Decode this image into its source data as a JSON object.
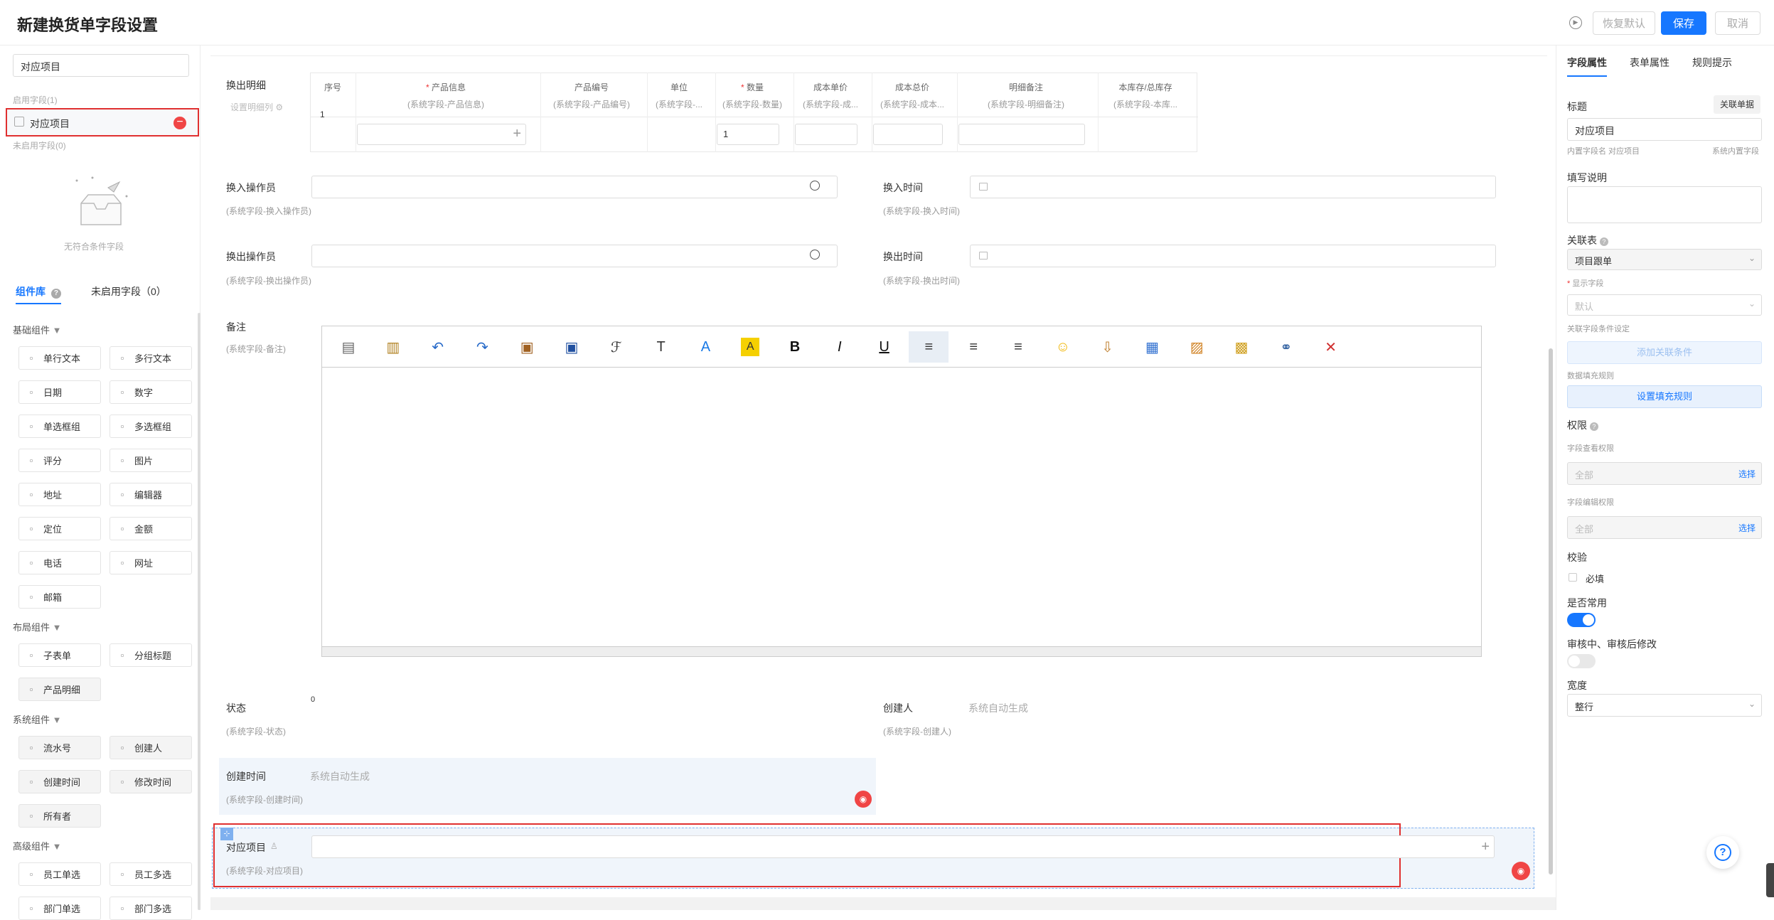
{
  "header": {
    "title": "新建换货单字段设置",
    "restore_label": "恢复默认",
    "save_label": "保存",
    "cancel_label": "取消"
  },
  "left": {
    "search_value": "对应项目",
    "enabled_heading": "启用字段(1)",
    "enabled_item": "对应项目",
    "disabled_heading": "未启用字段(0)",
    "empty_text": "无符合条件字段",
    "tab_library": "组件库",
    "tab_unused": "未启用字段（0）",
    "groups": {
      "basic": "基础组件",
      "layout": "布局组件",
      "system": "系统组件",
      "advanced": "高级组件"
    },
    "basic_items": [
      "单行文本",
      "多行文本",
      "日期",
      "数字",
      "单选框组",
      "多选框组",
      "评分",
      "图片",
      "地址",
      "编辑器",
      "定位",
      "金额",
      "电话",
      "网址",
      "邮箱"
    ],
    "layout_items": [
      "子表单",
      "分组标题",
      "产品明细"
    ],
    "system_items": [
      "流水号",
      "创建人",
      "创建时间",
      "修改时间",
      "所有者"
    ],
    "advanced_items": [
      "员工单选",
      "员工多选",
      "部门单选",
      "部门多选"
    ]
  },
  "form": {
    "detail_label": "换出明细",
    "detail_link": "设置明细列",
    "table_headers": [
      {
        "name": "序号",
        "sub": "",
        "req": false
      },
      {
        "name": "产品信息",
        "sub": "(系统字段-产品信息)",
        "req": true
      },
      {
        "name": "产品编号",
        "sub": "(系统字段-产品编号)",
        "req": false
      },
      {
        "name": "单位",
        "sub": "(系统字段-...",
        "req": false
      },
      {
        "name": "数量",
        "sub": "(系统字段-数量)",
        "req": true
      },
      {
        "name": "成本单价",
        "sub": "(系统字段-成...",
        "req": false
      },
      {
        "name": "成本总价",
        "sub": "(系统字段-成本...",
        "req": false
      },
      {
        "name": "明细备注",
        "sub": "(系统字段-明细备注)",
        "req": false
      },
      {
        "name": "本库存/总库存",
        "sub": "(系统字段-本库...",
        "req": false
      }
    ],
    "row_index": "1",
    "qty_value": "1",
    "in_operator": "换入操作员",
    "in_operator_sub": "(系统字段-换入操作员)",
    "in_time": "换入时间",
    "in_time_sub": "(系统字段-换入时间)",
    "out_operator": "换出操作员",
    "out_operator_sub": "(系统字段-换出操作员)",
    "out_time": "换出时间",
    "out_time_sub": "(系统字段-换出时间)",
    "remark": "备注",
    "remark_sub": "(系统字段-备注)",
    "status": "状态",
    "status_sub": "(系统字段-状态)",
    "status_value": "0",
    "creator": "创建人",
    "creator_sub": "(系统字段-创建人)",
    "creator_value": "系统自动生成",
    "created_time": "创建时间",
    "created_time_sub": "(系统字段-创建时间)",
    "created_time_value": "系统自动生成",
    "project": "对应项目",
    "project_sub": "(系统字段-对应项目)"
  },
  "right": {
    "tabs": [
      "字段属性",
      "表单属性",
      "规则提示"
    ],
    "title_label": "标题",
    "link_doc": "关联单据",
    "title_value": "对应项目",
    "internal_name": "内置字段名 对应项目",
    "system_builtin": "系统内置字段",
    "fill_note_label": "填写说明",
    "rel_table_label": "关联表",
    "rel_table_value": "项目跟单",
    "display_field_label": "显示字段",
    "display_field_value": "默认",
    "rel_condition_label": "关联字段条件设定",
    "add_condition": "添加关联条件",
    "fill_rule_label": "数据填充规则",
    "set_fill_rule": "设置填充规则",
    "permission_label": "权限",
    "view_perm_label": "字段查看权限",
    "view_perm_value": "全部",
    "choose": "选择",
    "edit_perm_label": "字段编辑权限",
    "edit_perm_value": "全部",
    "validate_label": "校验",
    "required_label": "必填",
    "common_label": "是否常用",
    "review_label": "审核中、审核后修改",
    "width_label": "宽度",
    "width_value": "整行"
  }
}
